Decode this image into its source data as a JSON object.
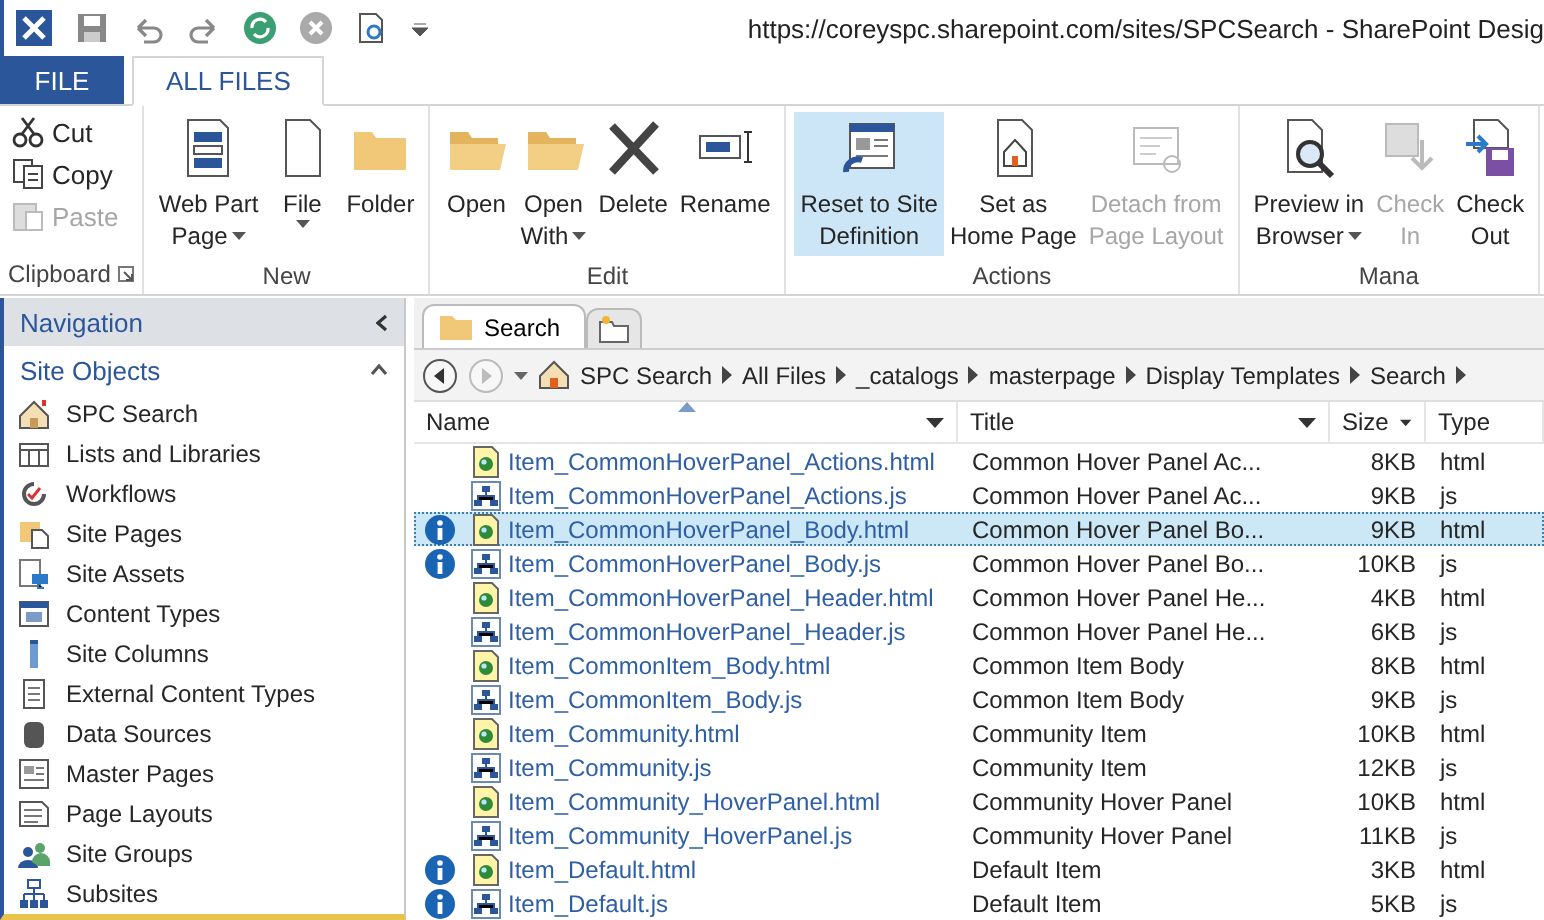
{
  "window": {
    "title": "https://coreyspc.sharepoint.com/sites/SPCSearch - SharePoint Desig"
  },
  "ribbon_tabs": [
    {
      "label": "FILE",
      "kind": "file",
      "selected": false
    },
    {
      "label": "ALL FILES",
      "kind": "tab",
      "selected": true
    }
  ],
  "ribbon": {
    "groups": [
      {
        "label": "Clipboard",
        "launcher": true,
        "buttons": [
          {
            "kind": "small",
            "lines": [
              "Cut"
            ],
            "disabled": false
          },
          {
            "kind": "small",
            "lines": [
              "Copy"
            ],
            "disabled": false
          },
          {
            "kind": "small",
            "lines": [
              "Paste"
            ],
            "disabled": true
          }
        ]
      },
      {
        "label": "New",
        "launcher": false,
        "buttons": [
          {
            "kind": "large",
            "lines": [
              "Web Part",
              "Page"
            ],
            "dropdown": true,
            "disabled": false,
            "selected": false
          },
          {
            "kind": "large",
            "lines": [
              "File"
            ],
            "dropdown": true,
            "disabled": false,
            "selected": false
          },
          {
            "kind": "large",
            "lines": [
              "Folder"
            ],
            "dropdown": false,
            "disabled": false,
            "selected": false
          }
        ]
      },
      {
        "label": "Edit",
        "launcher": false,
        "buttons": [
          {
            "kind": "large",
            "lines": [
              "Open"
            ],
            "dropdown": false,
            "disabled": false,
            "selected": false
          },
          {
            "kind": "large",
            "lines": [
              "Open",
              "With"
            ],
            "dropdown": true,
            "disabled": false,
            "selected": false
          },
          {
            "kind": "large",
            "lines": [
              "Delete"
            ],
            "dropdown": false,
            "disabled": false,
            "selected": false
          },
          {
            "kind": "large",
            "lines": [
              "Rename"
            ],
            "dropdown": false,
            "disabled": false,
            "selected": false
          }
        ]
      },
      {
        "label": "Actions",
        "launcher": false,
        "buttons": [
          {
            "kind": "large",
            "lines": [
              "Reset to Site",
              "Definition"
            ],
            "dropdown": false,
            "disabled": false,
            "selected": true
          },
          {
            "kind": "large",
            "lines": [
              "Set as",
              "Home Page"
            ],
            "dropdown": false,
            "disabled": false,
            "selected": false
          },
          {
            "kind": "large",
            "lines": [
              "Detach from",
              "Page Layout"
            ],
            "dropdown": false,
            "disabled": true,
            "selected": false
          }
        ]
      },
      {
        "label": "Mana",
        "launcher": false,
        "buttons": [
          {
            "kind": "large",
            "lines": [
              "Preview in",
              "Browser"
            ],
            "dropdown": true,
            "disabled": false,
            "selected": false
          },
          {
            "kind": "large",
            "lines": [
              "Check",
              "In"
            ],
            "dropdown": false,
            "disabled": true,
            "selected": false
          },
          {
            "kind": "large",
            "lines": [
              "Check",
              "Out"
            ],
            "dropdown": false,
            "disabled": false,
            "selected": false
          }
        ]
      }
    ]
  },
  "navigation": {
    "title": "Navigation",
    "section": "Site Objects",
    "items": [
      "SPC Search",
      "Lists and Libraries",
      "Workflows",
      "Site Pages",
      "Site Assets",
      "Content Types",
      "Site Columns",
      "External Content Types",
      "Data Sources",
      "Master Pages",
      "Page Layouts",
      "Site Groups",
      "Subsites"
    ]
  },
  "doc_tabs": [
    {
      "label": "Search",
      "selected": true
    }
  ],
  "breadcrumb": [
    "SPC Search",
    "All Files",
    "_catalogs",
    "masterpage",
    "Display Templates",
    "Search"
  ],
  "table": {
    "columns": [
      {
        "label": "Name",
        "filter": true,
        "sorted": true
      },
      {
        "label": "Title",
        "filter": true,
        "sorted": false
      },
      {
        "label": "Size",
        "filter": true,
        "sorted": false
      },
      {
        "label": "Type",
        "filter": false,
        "sorted": false
      }
    ],
    "rows": [
      {
        "name": "Item_CommonHoverPanel_Actions.html",
        "title": "Common Hover Panel Ac...",
        "size": "8KB",
        "type": "html",
        "kind": "html",
        "info": false,
        "selected": false
      },
      {
        "name": "Item_CommonHoverPanel_Actions.js",
        "title": "Common Hover Panel Ac...",
        "size": "9KB",
        "type": "js",
        "kind": "js",
        "info": false,
        "selected": false
      },
      {
        "name": "Item_CommonHoverPanel_Body.html",
        "title": "Common Hover Panel Bo...",
        "size": "9KB",
        "type": "html",
        "kind": "html",
        "info": true,
        "selected": true
      },
      {
        "name": "Item_CommonHoverPanel_Body.js",
        "title": "Common Hover Panel Bo...",
        "size": "10KB",
        "type": "js",
        "kind": "js",
        "info": true,
        "selected": false
      },
      {
        "name": "Item_CommonHoverPanel_Header.html",
        "title": "Common Hover Panel He...",
        "size": "4KB",
        "type": "html",
        "kind": "html",
        "info": false,
        "selected": false
      },
      {
        "name": "Item_CommonHoverPanel_Header.js",
        "title": "Common Hover Panel He...",
        "size": "6KB",
        "type": "js",
        "kind": "js",
        "info": false,
        "selected": false
      },
      {
        "name": "Item_CommonItem_Body.html",
        "title": "Common Item Body",
        "size": "8KB",
        "type": "html",
        "kind": "html",
        "info": false,
        "selected": false
      },
      {
        "name": "Item_CommonItem_Body.js",
        "title": "Common Item Body",
        "size": "9KB",
        "type": "js",
        "kind": "js",
        "info": false,
        "selected": false
      },
      {
        "name": "Item_Community.html",
        "title": "Community Item",
        "size": "10KB",
        "type": "html",
        "kind": "html",
        "info": false,
        "selected": false
      },
      {
        "name": "Item_Community.js",
        "title": "Community Item",
        "size": "12KB",
        "type": "js",
        "kind": "js",
        "info": false,
        "selected": false
      },
      {
        "name": "Item_Community_HoverPanel.html",
        "title": "Community Hover Panel",
        "size": "10KB",
        "type": "html",
        "kind": "html",
        "info": false,
        "selected": false
      },
      {
        "name": "Item_Community_HoverPanel.js",
        "title": "Community Hover Panel",
        "size": "11KB",
        "type": "js",
        "kind": "js",
        "info": false,
        "selected": false
      },
      {
        "name": "Item_Default.html",
        "title": "Default Item",
        "size": "3KB",
        "type": "html",
        "kind": "html",
        "info": true,
        "selected": false
      },
      {
        "name": "Item_Default.js",
        "title": "Default Item",
        "size": "5KB",
        "type": "js",
        "kind": "js",
        "info": true,
        "selected": false
      }
    ]
  }
}
